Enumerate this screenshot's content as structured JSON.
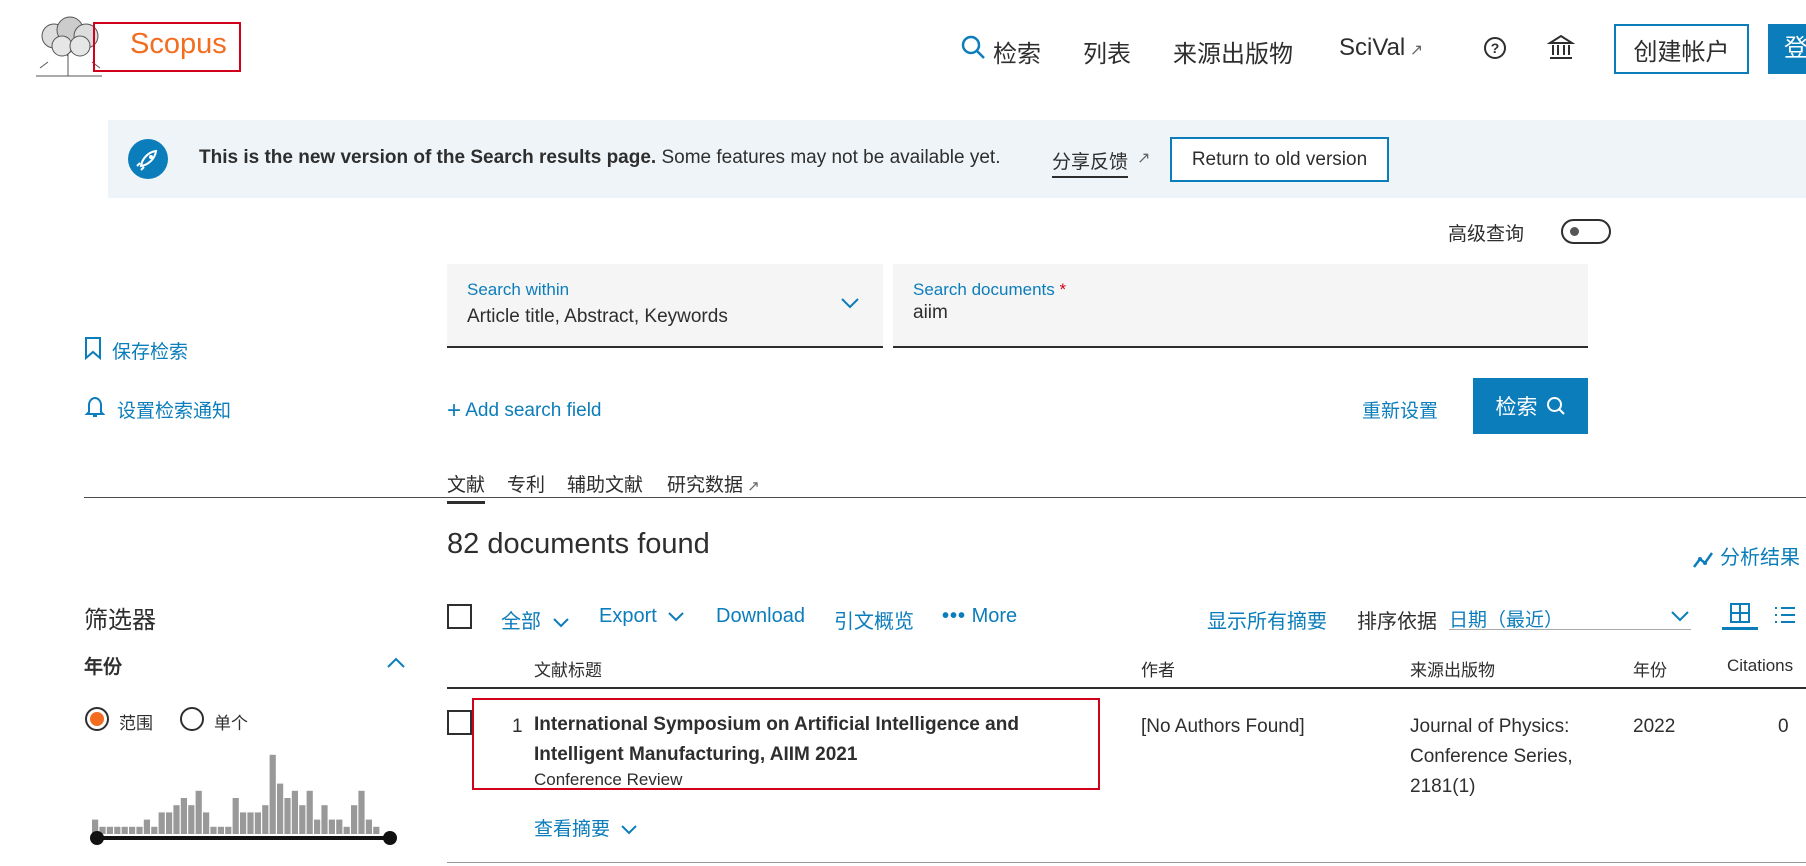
{
  "header": {
    "logo": "Scopus",
    "nav": {
      "search": "检索",
      "lists": "列表",
      "sources": "来源出版物",
      "scival": "SciVal"
    },
    "create_account": "创建帐户",
    "login": "登录"
  },
  "banner": {
    "bold": "This is the new version of the Search results page.",
    "text": "Some features may not be available yet.",
    "feedback": "分享反馈",
    "return_button": "Return to old version"
  },
  "advanced_query": {
    "label": "高级查询",
    "enabled": false
  },
  "search": {
    "within_label": "Search within",
    "within_value": "Article title, Abstract, Keywords",
    "docs_label": "Search documents",
    "required_mark": "*",
    "docs_value": "aiim",
    "add_field": "Add search field",
    "reset": "重新设置",
    "submit": "检索"
  },
  "sidebar": {
    "save_search": "保存检索",
    "set_alert": "设置检索通知",
    "filters_title": "筛选器",
    "year_title": "年份",
    "range_label": "范围",
    "single_label": "单个",
    "range_selected": true
  },
  "tabs": [
    "文献",
    "专利",
    "辅助文献",
    "研究数据"
  ],
  "results": {
    "count_text": "82 documents found",
    "analyze": "分析结果",
    "toolbar": {
      "all": "全部",
      "export": "Export",
      "download": "Download",
      "citation_overview": "引文概览",
      "more": "More",
      "show_abstracts": "显示所有摘要",
      "sort_label": "排序依据",
      "sort_value": "日期（最近）"
    },
    "columns": {
      "title": "文献标题",
      "authors": "作者",
      "source": "来源出版物",
      "year": "年份",
      "citations": "Citations"
    },
    "rows": [
      {
        "index": "1",
        "title": "International Symposium on Artificial Intelligence and Intelligent Manufacturing, AIIM 2021",
        "doc_type": "Conference Review",
        "authors": "[No Authors Found]",
        "source_line1": "Journal of Physics:",
        "source_line2": "Conference Series,",
        "source_line3": "2181(1)",
        "year": "2022",
        "citations": "0",
        "view_abstract": "查看摘要"
      }
    ]
  },
  "colors": {
    "brand_blue": "#0c7dbb",
    "logo_orange": "#f36d21",
    "highlight_red": "#d0021b"
  },
  "year_histogram": [
    2,
    1,
    1,
    1,
    1,
    1,
    1,
    2,
    1,
    3,
    3,
    4,
    5,
    4,
    6,
    3,
    1,
    1,
    1,
    5,
    3,
    3,
    3,
    4,
    11,
    7,
    5,
    6,
    4,
    6,
    2,
    4,
    2,
    2,
    1,
    4,
    6,
    2,
    1
  ]
}
